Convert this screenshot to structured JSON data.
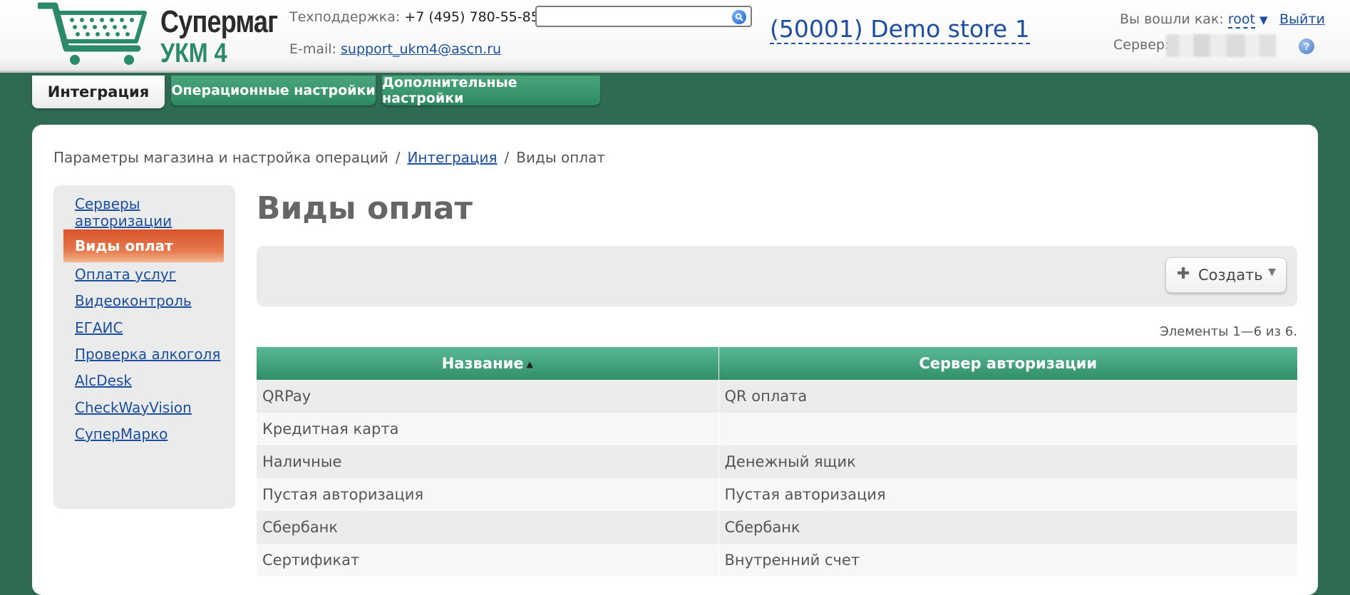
{
  "header": {
    "logo_line1": "Супермаг",
    "logo_line2": "УКМ 4",
    "support_label": "Техподдержка:",
    "support_phone": "+7 (495) 780-55-85",
    "email_label": "E-mail:",
    "email": "support_ukm4@ascn.ru",
    "search_value": "",
    "store": "(50001) Demo store 1",
    "logged_label": "Вы вошли как:",
    "user": "root",
    "logout": "Выйти",
    "server_label": "Сервер:",
    "help": "?"
  },
  "tabs": [
    {
      "label": "Интеграция",
      "active": true
    },
    {
      "label": "Операционные настройки",
      "active": false
    },
    {
      "label": "Дополнительные настройки",
      "active": false
    }
  ],
  "breadcrumb": {
    "root": "Параметры магазина и настройка операций",
    "sep": "/",
    "link": "Интеграция",
    "current": "Виды оплат"
  },
  "sidebar": {
    "items": [
      {
        "label": "Серверы авторизации",
        "active": false
      },
      {
        "label": "Виды оплат",
        "active": true
      },
      {
        "label": "Оплата услуг",
        "active": false
      },
      {
        "label": "Видеоконтроль",
        "active": false
      },
      {
        "label": "ЕГАИС",
        "active": false
      },
      {
        "label": "Проверка алкоголя",
        "active": false
      },
      {
        "label": "AlcDesk",
        "active": false
      },
      {
        "label": "CheckWayVision",
        "active": false
      },
      {
        "label": "СуперМарко",
        "active": false
      }
    ]
  },
  "main": {
    "title": "Виды оплат",
    "create_button": "Создать",
    "elements_count": "Элементы 1—6 из 6.",
    "columns": [
      "Название",
      "Сервер авторизации"
    ],
    "rows": [
      [
        "QRPay",
        "QR оплата"
      ],
      [
        "Кредитная карта",
        ""
      ],
      [
        "Наличные",
        "Денежный ящик"
      ],
      [
        "Пустая авторизация",
        "Пустая авторизация"
      ],
      [
        "Сбербанк",
        "Сбербанк"
      ],
      [
        "Сертификат",
        "Внутренний счет"
      ]
    ]
  },
  "colors": {
    "background": "#2f6b53",
    "tab_green": "#3a9a6e",
    "active_nav": "#e0643a",
    "link": "#1a4fa0",
    "grid_header": "#4aa87f"
  }
}
